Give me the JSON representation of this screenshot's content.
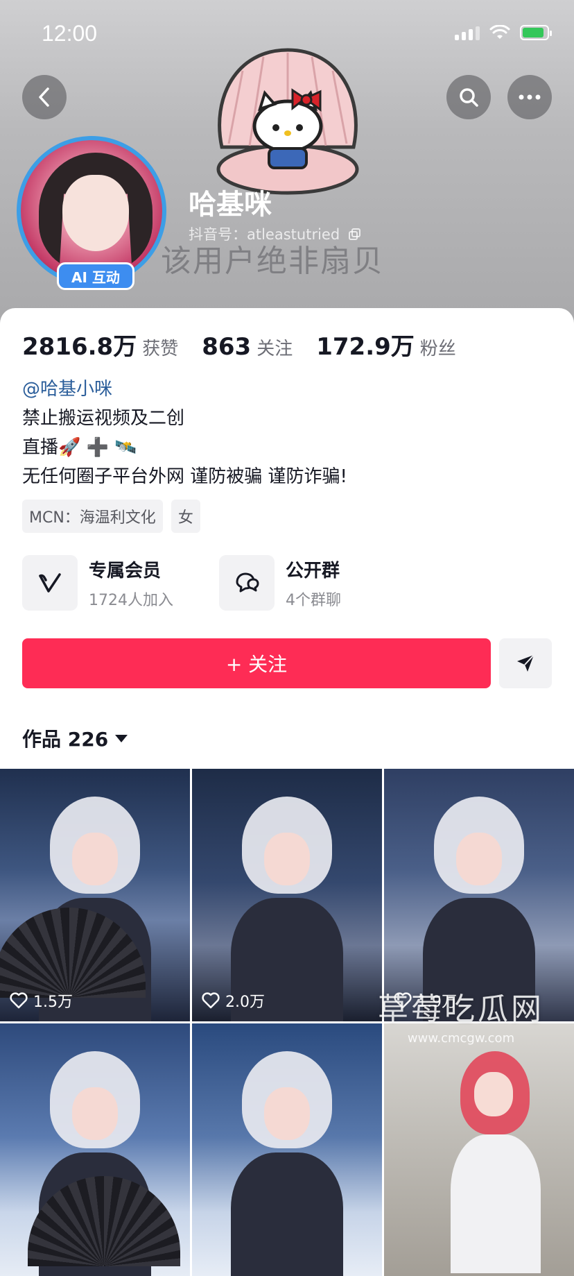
{
  "status_bar": {
    "time": "12:00"
  },
  "header": {
    "nickname": "哈基咪",
    "douyin_id": "抖音号：atleastutried",
    "overlay_text": "该用户绝非扇贝",
    "ai_badge": "AI 互动",
    "avatar_ring_color": "#3d9ee6"
  },
  "stats": [
    {
      "value": "2816.8万",
      "label": "获赞"
    },
    {
      "value": "863",
      "label": "关注"
    },
    {
      "value": "172.9万",
      "label": "粉丝"
    }
  ],
  "bio": {
    "mention": "@哈基小咪",
    "lines": [
      "禁止搬运视频及二创",
      "直播🚀 ➕ 🛰️",
      "无任何圈子平台外网 谨防被骗 谨防诈骗!"
    ]
  },
  "tags": [
    "MCN：海温利文化",
    "女"
  ],
  "features": [
    {
      "title": "专属会员",
      "subtitle": "1724人加入",
      "icon": "v-icon"
    },
    {
      "title": "公开群",
      "subtitle": "4个群聊",
      "icon": "chat-icon"
    }
  ],
  "actions": {
    "follow_label": "+ 关注",
    "follow_color": "#fe2c55"
  },
  "works": {
    "header": "作品 226",
    "items": [
      {
        "likes": "1.5万"
      },
      {
        "likes": "2.0万"
      },
      {
        "likes": "1.9万"
      },
      {
        "likes": ""
      },
      {
        "likes": ""
      },
      {
        "likes": ""
      }
    ]
  },
  "watermark": {
    "title": "草莓吃瓜网",
    "url": "www.cmcgw.com"
  }
}
